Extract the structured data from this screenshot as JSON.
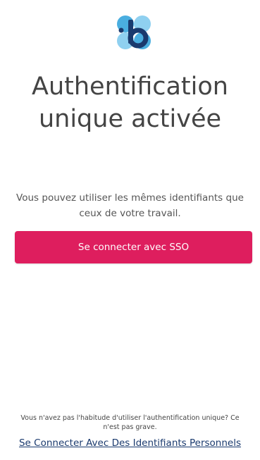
{
  "brand": {
    "logo_icon": "b-app-logo-icon",
    "primary_color": "#1a3a6e",
    "light_blue": "#4aaee0",
    "pale_blue": "#8fd0f0"
  },
  "heading": {
    "line1": "Authentification",
    "line2": "unique activée"
  },
  "description": {
    "line1": "Vous pouvez utiliser les mêmes identifiants que",
    "line2": "ceux de votre travail."
  },
  "sso_button": {
    "label": "Se connecter avec SSO",
    "color": "#de1e5e"
  },
  "footer": {
    "note_line1": "Vous n'avez pas l'habitude d'utiliser l'authentification unique? Ce",
    "note_line2": "n'est pas grave.",
    "link_label": "Se Connecter Avec Des Identifiants Personnels"
  }
}
